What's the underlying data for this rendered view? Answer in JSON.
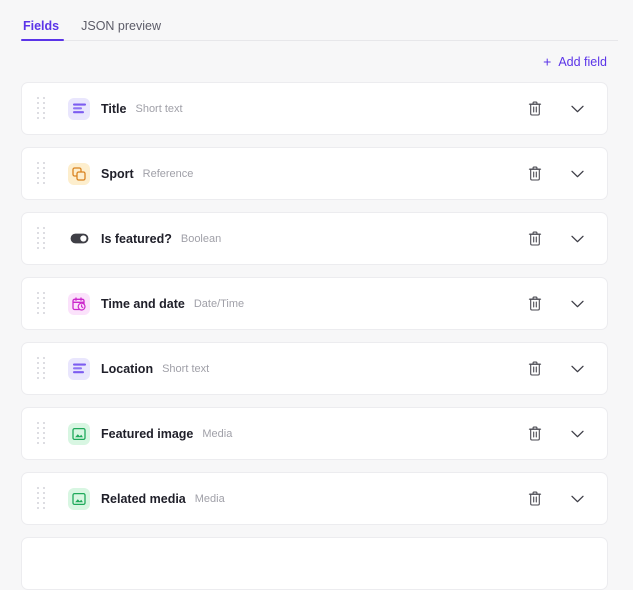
{
  "tabs": [
    {
      "label": "Fields",
      "name": "tab-fields",
      "active": true
    },
    {
      "label": "JSON preview",
      "name": "tab-json-preview",
      "active": false
    }
  ],
  "toolbar": {
    "add_field_label": "Add field",
    "plus_glyph": "+",
    "accent_color": "#5b34e8"
  },
  "colors": {
    "accent": "#5b34e8",
    "page_background": "#f7f7f8",
    "card_background": "#ffffff",
    "card_border": "#ececef",
    "label_text": "#20202a",
    "type_text": "#a0a0a8",
    "icon_action": "#4a4a52"
  },
  "fields": [
    {
      "label": "Title",
      "type": "Short text",
      "icon": "short-text-icon",
      "icon_bg": "#e9e6fd",
      "icon_fg": "#7c5cf0"
    },
    {
      "label": "Sport",
      "type": "Reference",
      "icon": "reference-icon",
      "icon_bg": "#fdeecd",
      "icon_fg": "#d9821e"
    },
    {
      "label": "Is featured?",
      "type": "Boolean",
      "icon": "boolean-toggle-icon",
      "icon_bg": "#ffffff",
      "icon_fg": "#3f3f46"
    },
    {
      "label": "Time and date",
      "type": "Date/Time",
      "icon": "date-time-icon",
      "icon_bg": "#fbe2fb",
      "icon_fg": "#cc29cc"
    },
    {
      "label": "Location",
      "type": "Short text",
      "icon": "short-text-icon",
      "icon_bg": "#e9e6fd",
      "icon_fg": "#7c5cf0"
    },
    {
      "label": "Featured image",
      "type": "Media",
      "icon": "media-icon",
      "icon_bg": "#d8f6e2",
      "icon_fg": "#1ea95a"
    },
    {
      "label": "Related media",
      "type": "Media",
      "icon": "media-icon",
      "icon_bg": "#d8f6e2",
      "icon_fg": "#1ea95a"
    },
    {
      "label": "",
      "type": "",
      "icon": "none",
      "icon_bg": "#ffffff",
      "icon_fg": "#ffffff"
    }
  ],
  "row_actions": {
    "delete_name": "delete-field-button",
    "expand_name": "expand-field-button"
  }
}
